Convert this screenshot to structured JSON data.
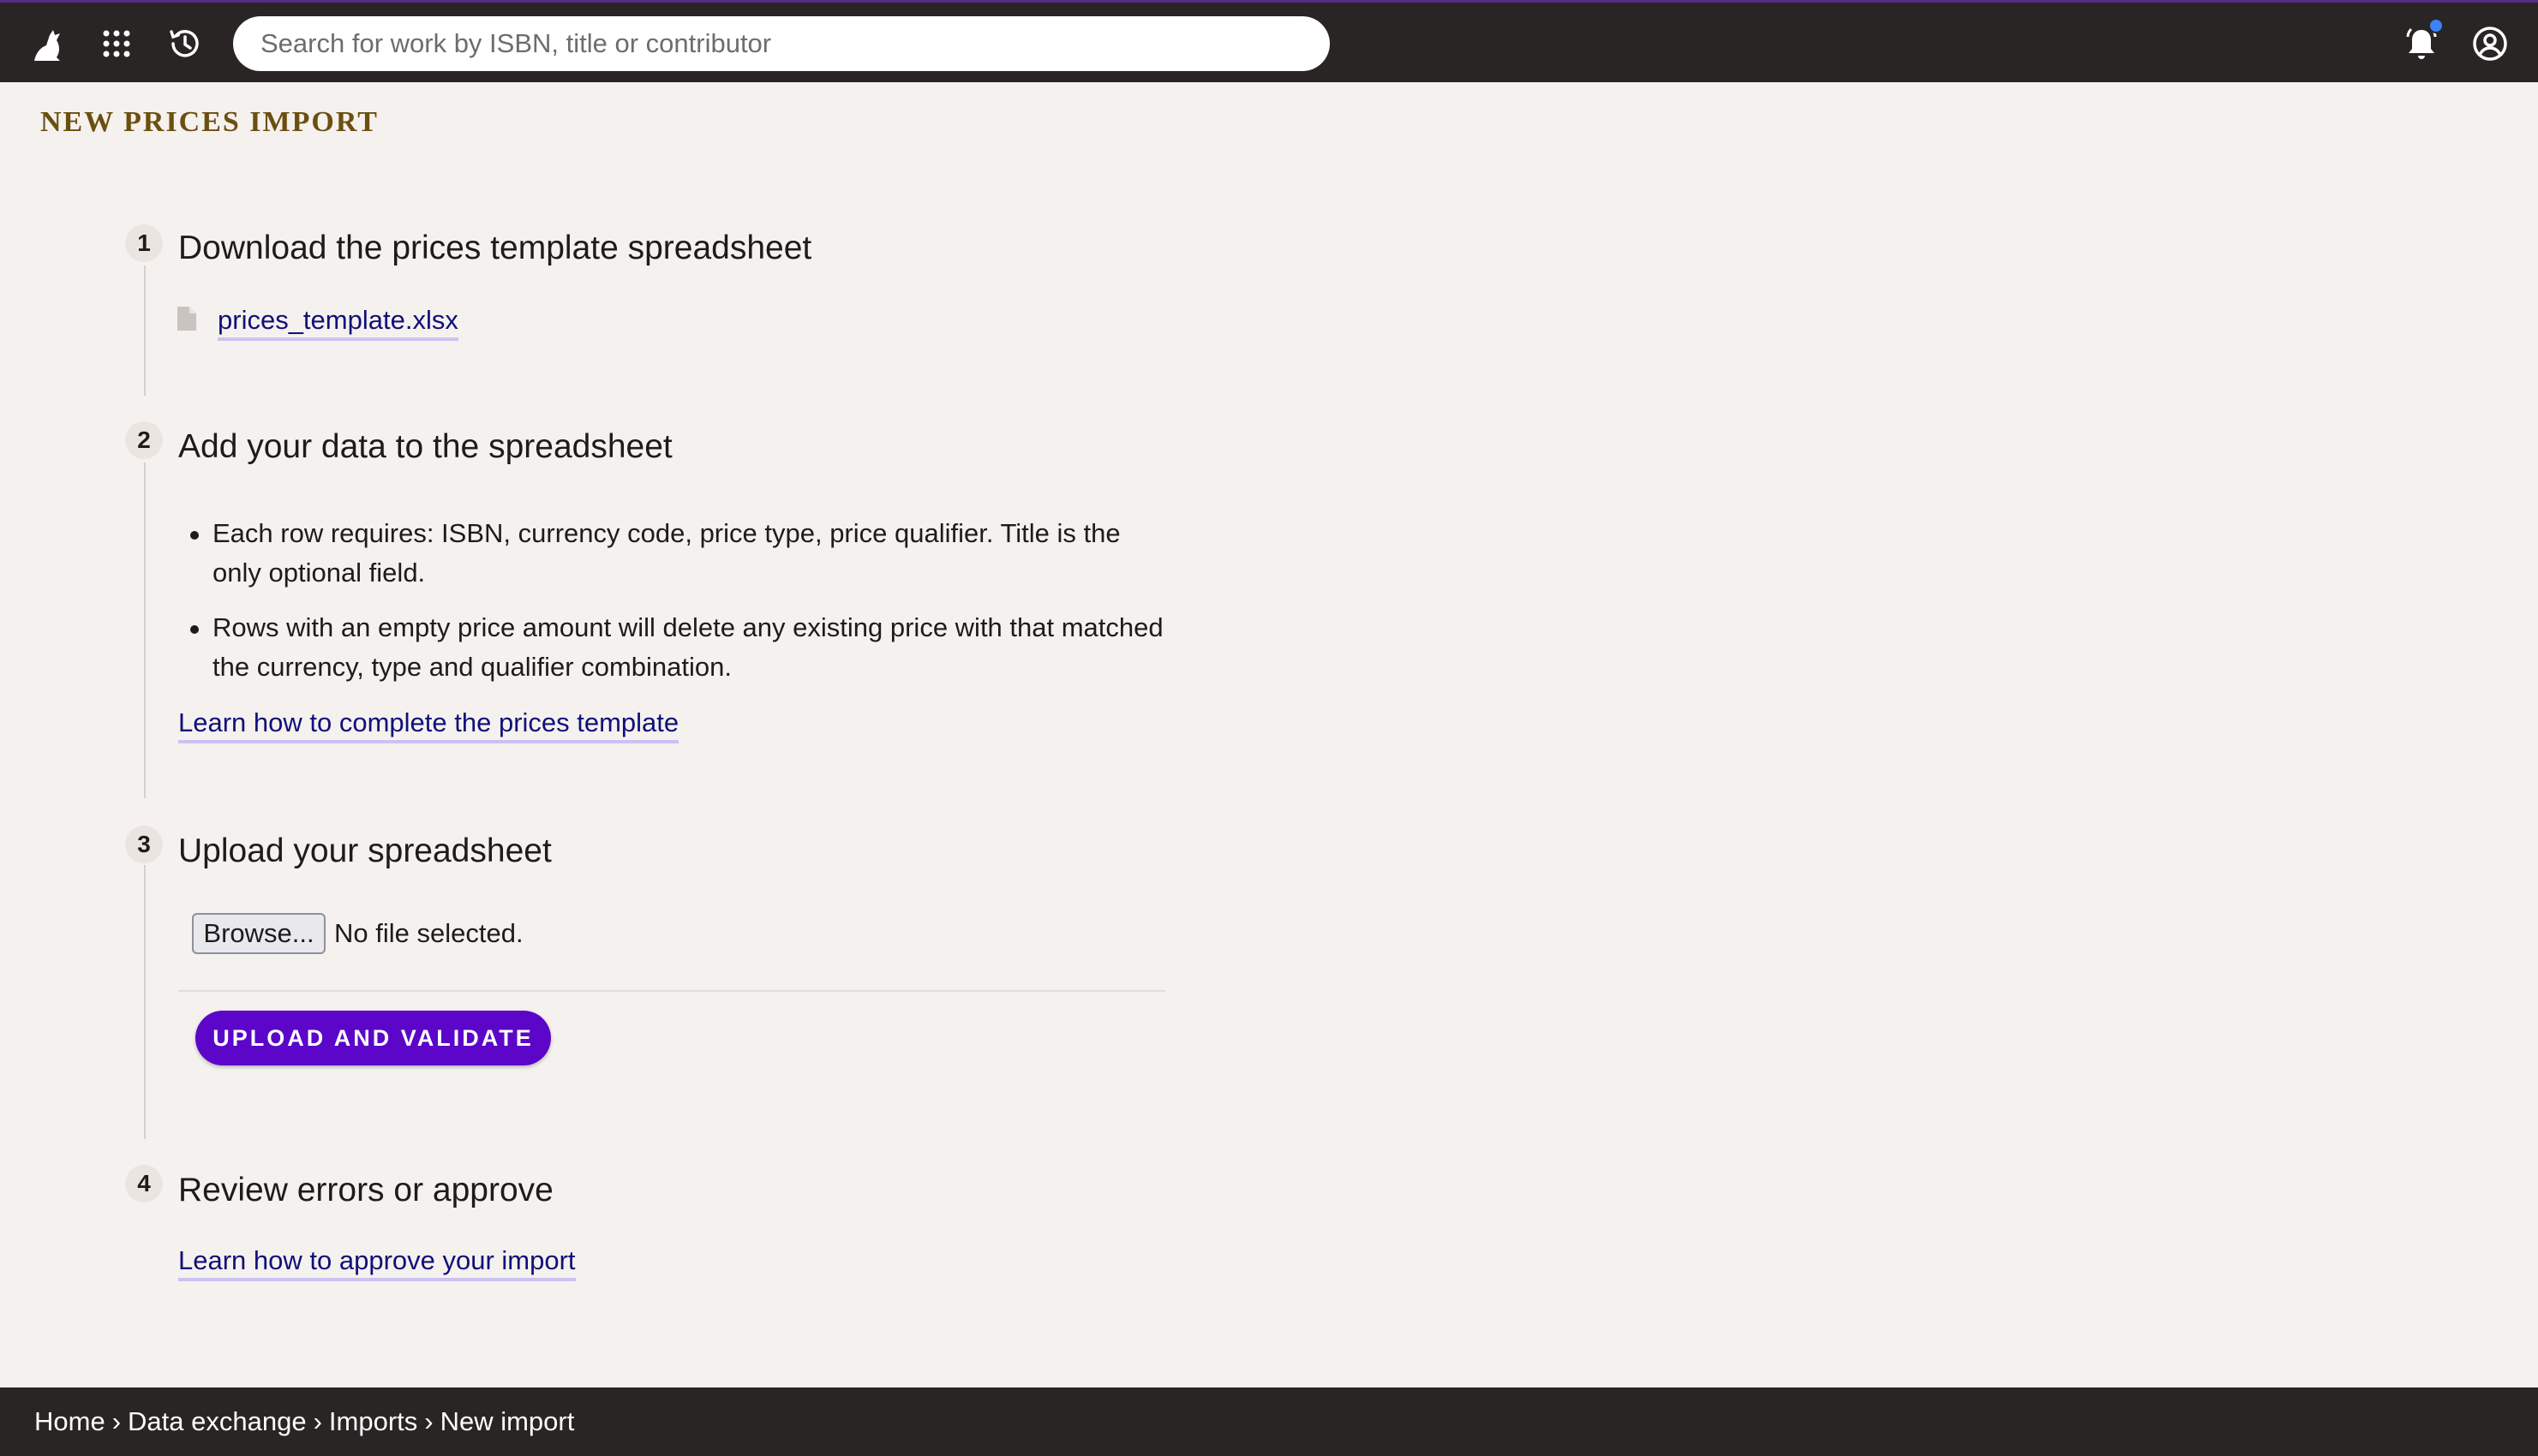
{
  "header": {
    "search_placeholder": "Search for work by ISBN, title or contributor",
    "icons": [
      "logo-icon",
      "apps-grid-icon",
      "history-icon",
      "bell-icon",
      "user-account-icon"
    ]
  },
  "page": {
    "title": "NEW PRICES IMPORT"
  },
  "steps": [
    {
      "number": "1",
      "title": "Download the prices template spreadsheet",
      "file_link": "prices_template.xlsx"
    },
    {
      "number": "2",
      "title": "Add your data to the spreadsheet",
      "bullets": [
        "Each row requires: ISBN, currency code, price type, price qualifier. Title is the only optional field.",
        "Rows with an empty price amount will delete any existing price with that matched the currency, type and qualifier combination."
      ],
      "link": "Learn how to complete the prices template"
    },
    {
      "number": "3",
      "title": "Upload your spreadsheet",
      "browse_label": "Browse...",
      "file_status": "No file selected.",
      "submit_label": "UPLOAD AND VALIDATE"
    },
    {
      "number": "4",
      "title": "Review errors or approve",
      "link": "Learn how to approve your import"
    }
  ],
  "breadcrumb": {
    "items": [
      "Home",
      "Data exchange",
      "Imports",
      "New import"
    ],
    "separator": "›"
  },
  "colors": {
    "topbar": "#292524",
    "background": "#f5f1ee",
    "accent_button": "#5b06c9",
    "title": "#6b4f10",
    "link": "#10107a",
    "notification_dot": "#3b82f6"
  }
}
